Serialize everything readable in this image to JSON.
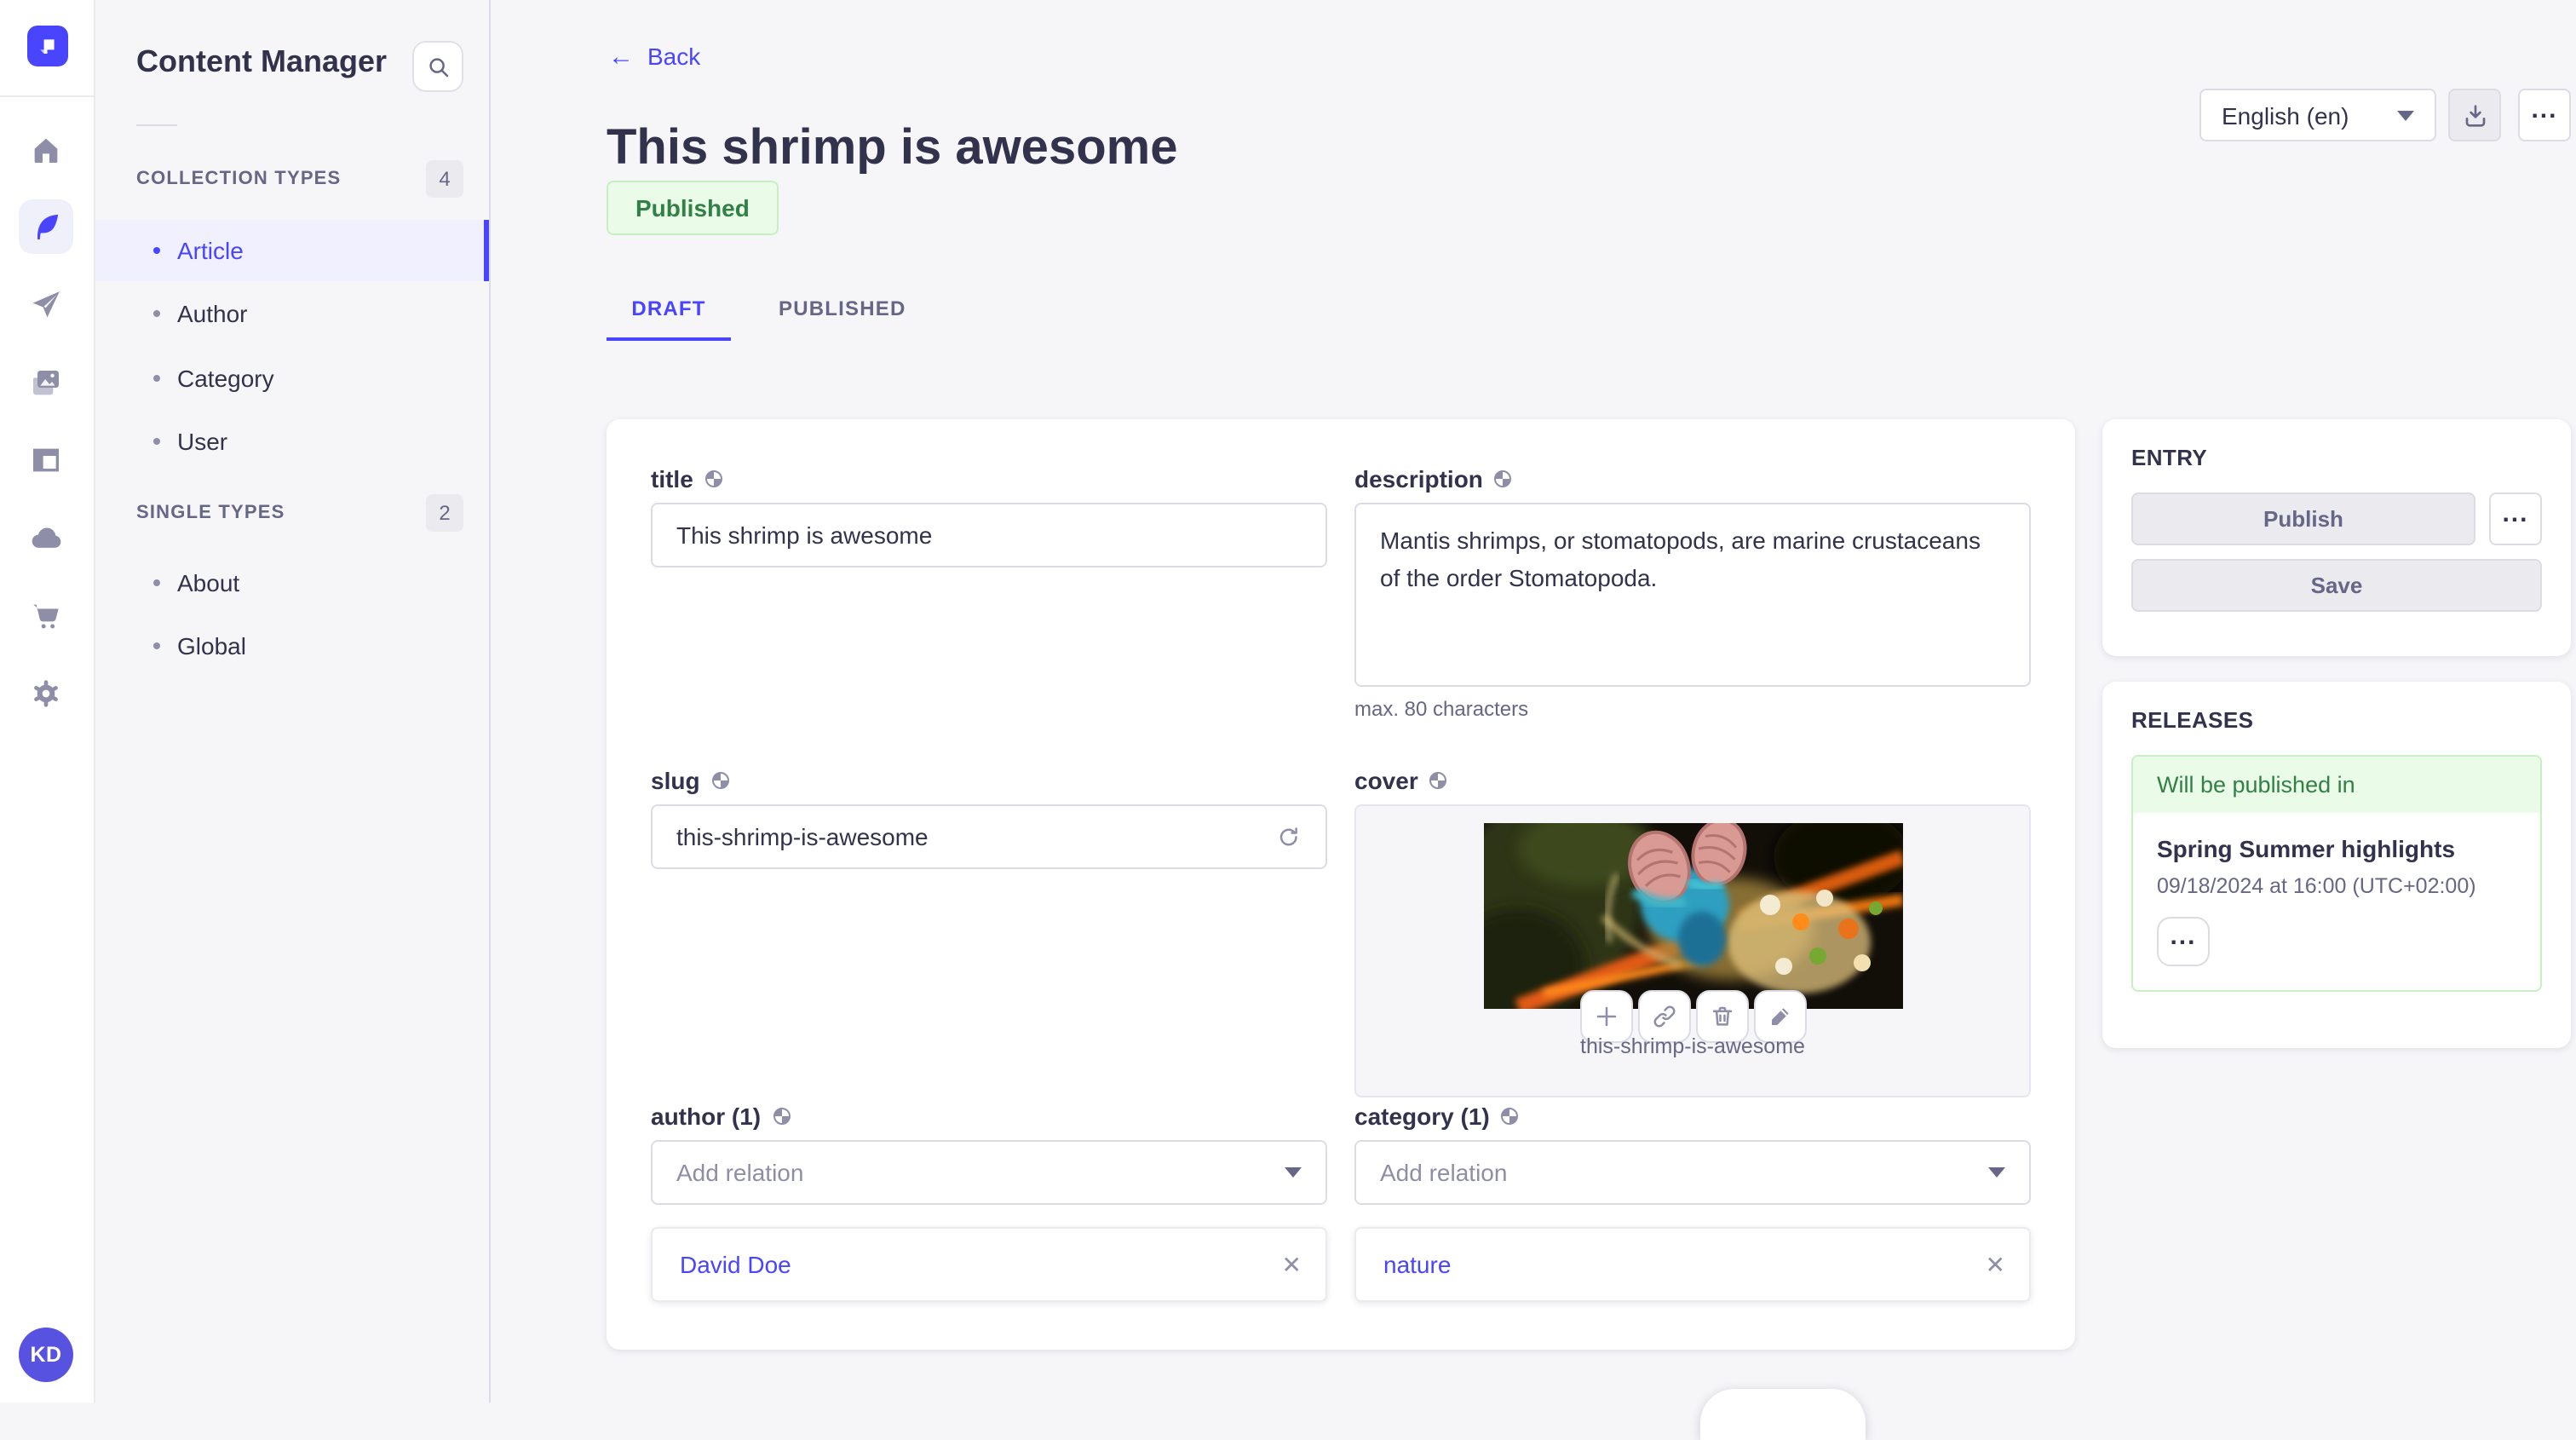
{
  "colors": {
    "accent": "#4945ff",
    "background": "#f6f6f9",
    "surface": "#ffffff",
    "border": "#dcdce4",
    "text": "#32324d",
    "text_muted": "#666687",
    "text_subtle": "#8e8ea9",
    "success_text": "#328048",
    "success_bg": "#eafbe7",
    "success_border": "#c6f0c2",
    "avatar_bg": "#5752e0"
  },
  "icons": {
    "rail": [
      "strapi-logo",
      "home",
      "content-feather",
      "send-plane",
      "media-pictures",
      "layout-blocks",
      "cloud",
      "cart",
      "gear"
    ],
    "other": [
      "search",
      "globe-locale",
      "regenerate",
      "plus",
      "link",
      "trash",
      "pencil",
      "download",
      "more-dots",
      "caret-down",
      "close-x",
      "back-arrow"
    ]
  },
  "subnav": {
    "title": "Content Manager",
    "sections": [
      {
        "label": "COLLECTION TYPES",
        "count": "4",
        "items": [
          {
            "label": "Article",
            "active": true
          },
          {
            "label": "Author"
          },
          {
            "label": "Category"
          },
          {
            "label": "User"
          }
        ]
      },
      {
        "label": "SINGLE TYPES",
        "count": "2",
        "items": [
          {
            "label": "About"
          },
          {
            "label": "Global"
          }
        ]
      }
    ]
  },
  "header": {
    "back_label": "Back",
    "title": "This shrimp is awesome",
    "status_badge": "Published",
    "locale_select": "English (en)",
    "more_label": "...",
    "tabs": [
      {
        "label": "DRAFT",
        "active": true
      },
      {
        "label": "PUBLISHED",
        "active": false
      }
    ]
  },
  "form": {
    "title": {
      "label": "title",
      "value": "This shrimp is awesome"
    },
    "description": {
      "label": "description",
      "value": "Mantis shrimps, or stomatopods, are marine crustaceans of the order Stomatopoda.",
      "hint": "max. 80 characters"
    },
    "slug": {
      "label": "slug",
      "value": "this-shrimp-is-awesome"
    },
    "cover": {
      "label": "cover",
      "caption": "this-shrimp-is-awesome"
    },
    "author": {
      "label": "author (1)",
      "placeholder": "Add relation",
      "relation": "David Doe",
      "remove_label": "✕"
    },
    "category": {
      "label": "category (1)",
      "placeholder": "Add relation",
      "relation": "nature",
      "remove_label": "✕"
    }
  },
  "entry_panel": {
    "title": "ENTRY",
    "publish_label": "Publish",
    "save_label": "Save",
    "more_label": "..."
  },
  "releases_panel": {
    "title": "RELEASES",
    "status": "Will be published in",
    "release_name": "Spring Summer highlights",
    "release_date": "09/18/2024 at 16:00 (UTC+02:00)",
    "more_label": "..."
  },
  "user": {
    "initials": "KD"
  }
}
